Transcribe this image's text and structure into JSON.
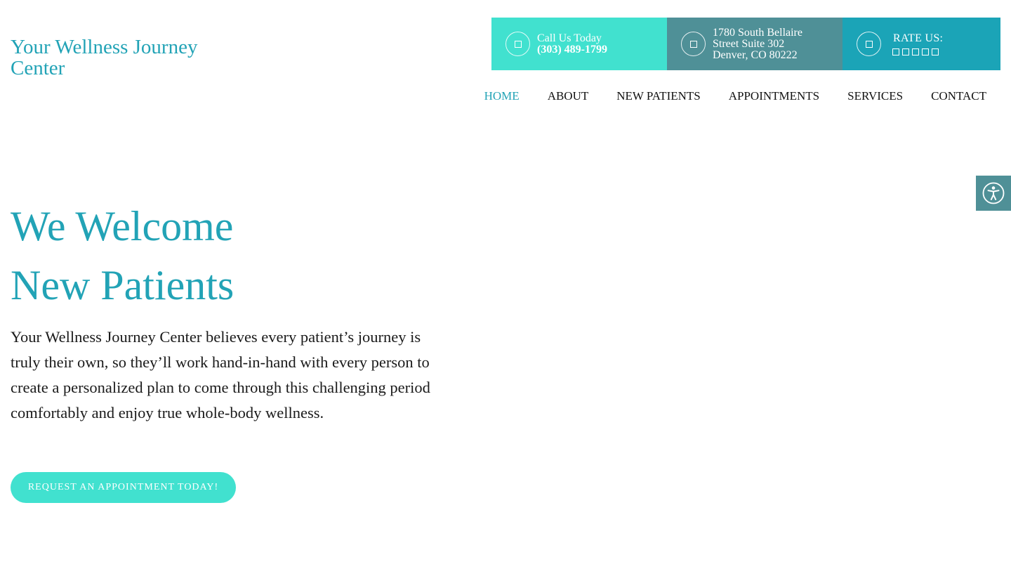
{
  "brand": {
    "logo_text": "Your Wellness Journey Center"
  },
  "info_bar": {
    "call_label": "Call Us Today",
    "phone": "(303) 489-1799",
    "address_line1": "1780 South Bellaire",
    "address_line2": "Street Suite 302",
    "address_line3": "Denver, CO 80222",
    "rate_label": "RATE US:",
    "star_count": 5,
    "icon_call": "phone-icon",
    "icon_address": "location-icon",
    "icon_rate": "star-icon"
  },
  "nav": {
    "items": [
      "HOME",
      "ABOUT",
      "NEW PATIENTS",
      "APPOINTMENTS",
      "SERVICES",
      "CONTACT"
    ],
    "active": "HOME"
  },
  "hero": {
    "title_line1": "We Welcome",
    "title_line2": "New Patients",
    "body": "Your Wellness Journey Center believes every patient’s journey is truly their own, so they’ll work hand-in-hand with every person to create a personalized plan to come through this challenging period comfortably and enjoy true whole-body wellness.",
    "cta_label": "REQUEST AN APPOINTMENT TODAY!"
  },
  "accessibility": {
    "icon": "accessibility-icon"
  },
  "colors": {
    "brand_teal": "#22a3b6",
    "turquoise": "#41e1cf",
    "slate_teal": "#4f9097",
    "deep_teal": "#1ba4b7"
  }
}
